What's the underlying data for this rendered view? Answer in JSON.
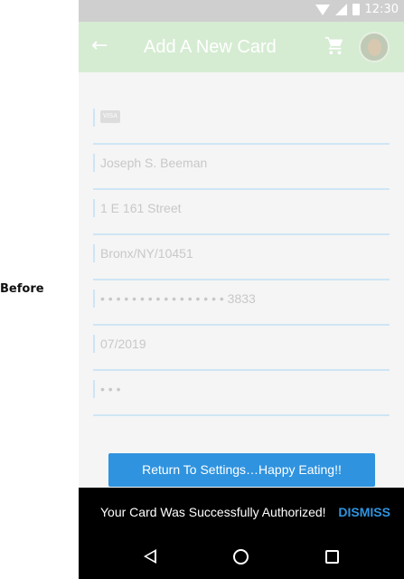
{
  "side_label": "Before",
  "status_bar": {
    "time": "12:30"
  },
  "app_bar": {
    "title": "Add A New Card"
  },
  "form": {
    "card_brand_badge": "VISA",
    "name": "Joseph S. Beeman",
    "address": "1 E 161 Street",
    "city_state_zip": "Bronx/NY/10451",
    "card_number": "• • • • • • • • • • • • • • • • 3833",
    "expiry": "07/2019",
    "cvv": "• • •"
  },
  "return_button_label": "Return To Settings…Happy Eating!!",
  "snackbar": {
    "message": "Your Card Was Successfully Authorized!",
    "action": "DISMISS"
  },
  "colors": {
    "accent_blue": "#2f93df",
    "appbar_green_faded": "#d5ecd2",
    "field_underline": "#cfe6f5",
    "snackbar_bg": "#000000"
  },
  "icons": [
    "wifi-icon",
    "signal-icon",
    "battery-icon",
    "back-arrow-icon",
    "shopping-cart-icon",
    "avatar",
    "nav-back-icon",
    "nav-home-icon",
    "nav-recents-icon"
  ]
}
